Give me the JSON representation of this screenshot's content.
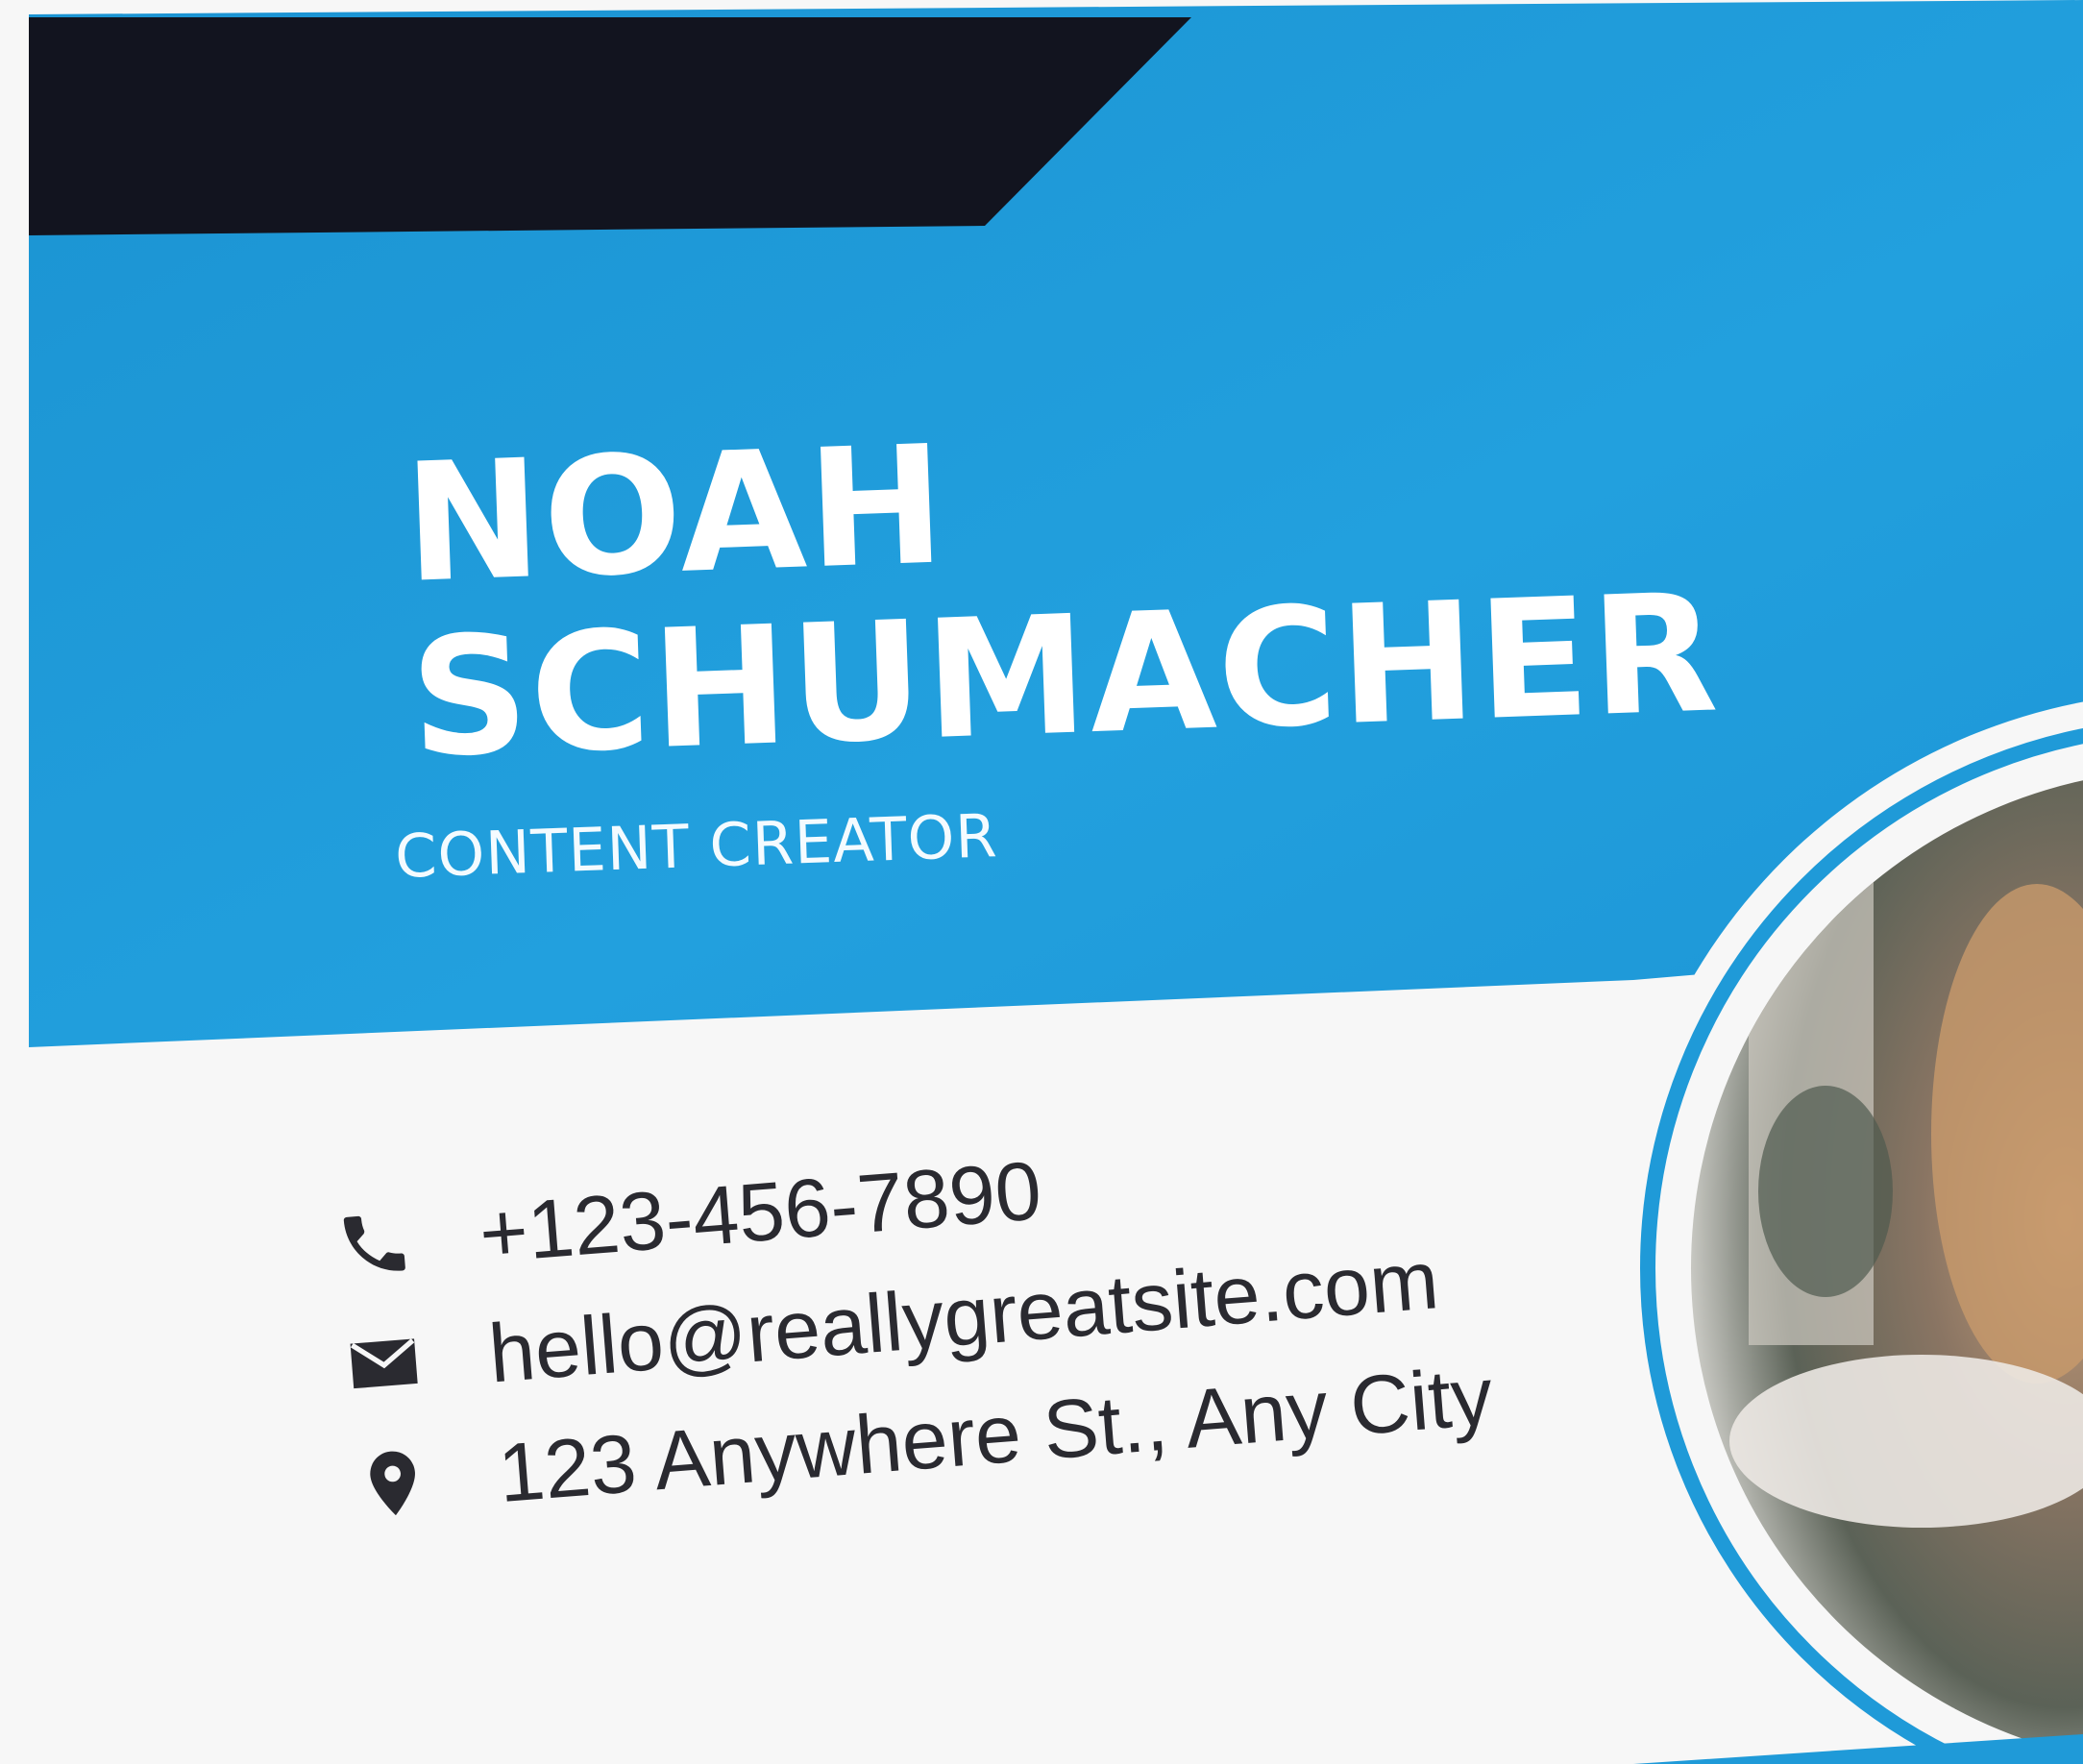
{
  "card": {
    "name_first": "NOAH",
    "name_last": "SCHUMACHER",
    "job_title": "CONTENT CREATOR"
  },
  "contacts": {
    "phone": "+123-456-7890",
    "email": "hello@reallygreatsite.com",
    "address": "123 Anywhere St., Any City"
  },
  "icons": {
    "phone": "phone-icon",
    "email": "envelope-icon",
    "address": "map-pin-icon"
  },
  "colors": {
    "brand_blue": "#1f9ad8",
    "dark_navy": "#12141f",
    "text_dark": "#2a2a30",
    "background": "#f7f7f7"
  }
}
